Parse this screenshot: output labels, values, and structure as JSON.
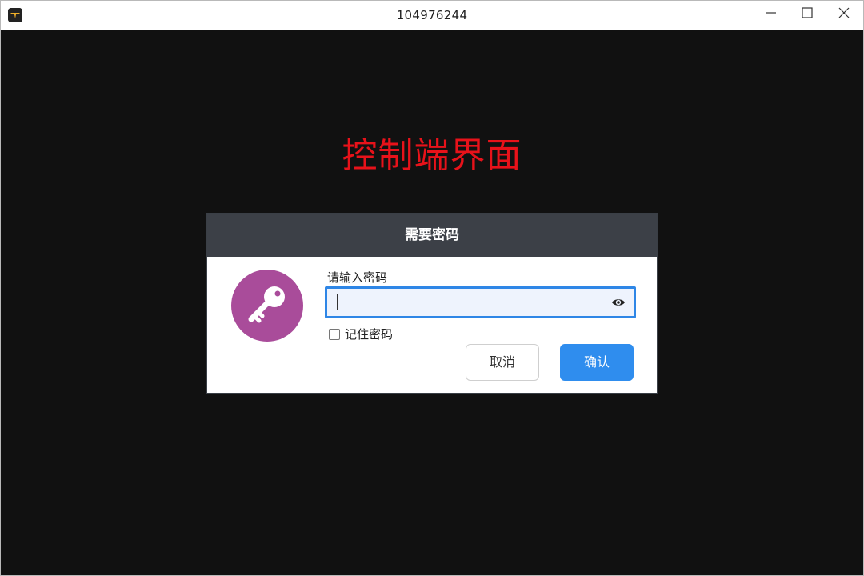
{
  "window": {
    "title": "104976244"
  },
  "page": {
    "heading": "控制端界面"
  },
  "dialog": {
    "title": "需要密码",
    "password_label": "请输入密码",
    "password_value": "",
    "remember_label": "记住密码",
    "remember_checked": false,
    "cancel_label": "取消",
    "ok_label": "确认"
  },
  "icons": {
    "app": "app-icon",
    "key": "key-icon",
    "eye": "eye-icon",
    "minimize": "minimize-icon",
    "maximize": "maximize-icon",
    "close": "close-icon"
  },
  "colors": {
    "heading": "#e8121a",
    "dialog_header": "#3c4047",
    "avatar": "#a94c9a",
    "input_focus": "#2e86e6",
    "primary": "#2f8dee",
    "background": "#111111"
  }
}
